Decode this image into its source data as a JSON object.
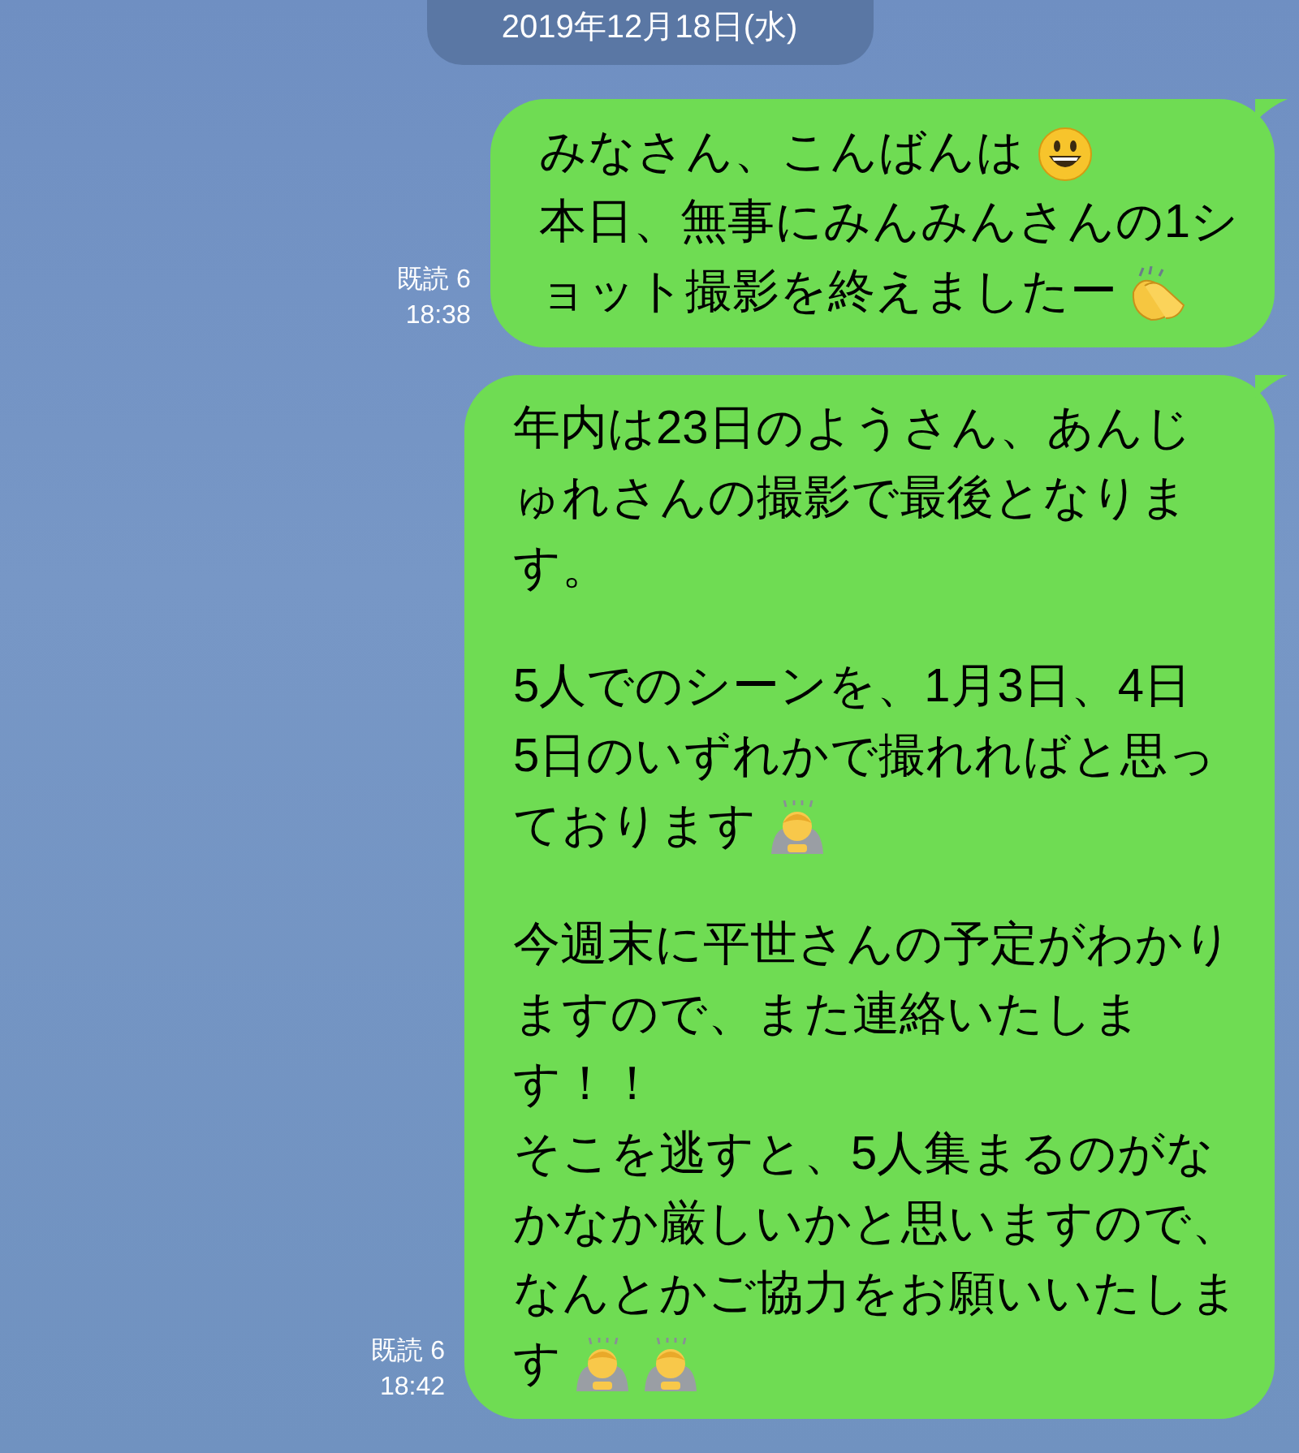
{
  "date_label": "2019年12月18日(水)",
  "messages": [
    {
      "read": "既読 6",
      "time": "18:38",
      "paragraphs": [
        {
          "lines": [
            {
              "text": "みなさん、こんばんは",
              "icons": [
                {
                  "kind": "smile"
                }
              ]
            },
            {
              "text": "本日、無事にみんみんさんの1シ"
            },
            {
              "text": "ョット撮影を終えましたー",
              "icons": [
                {
                  "kind": "clap"
                }
              ]
            }
          ]
        }
      ]
    },
    {
      "read": "既読 6",
      "time": "18:42",
      "paragraphs": [
        {
          "lines": [
            {
              "text": "年内は23日のようさん、あんじ"
            },
            {
              "text": "ゅれさんの撮影で最後となりま"
            },
            {
              "text": "す。"
            }
          ]
        },
        {
          "lines": [
            {
              "text": "5人でのシーンを、1月3日、4日"
            },
            {
              "text": "5日のいずれかで撮れればと思っ"
            },
            {
              "text": "ております",
              "icons": [
                {
                  "kind": "bow"
                }
              ]
            }
          ]
        },
        {
          "lines": [
            {
              "text": "今週末に平世さんの予定がわかり"
            },
            {
              "text": "ますので、また連絡いたしま"
            },
            {
              "text": "す！！"
            },
            {
              "text": "そこを逃すと、5人集まるのがな"
            },
            {
              "text": "かなか厳しいかと思いますので、"
            },
            {
              "text": "なんとかご協力をお願いいたしま"
            },
            {
              "text": "す",
              "icons": [
                {
                  "kind": "bow"
                },
                {
                  "kind": "bow"
                }
              ]
            }
          ]
        }
      ]
    }
  ]
}
